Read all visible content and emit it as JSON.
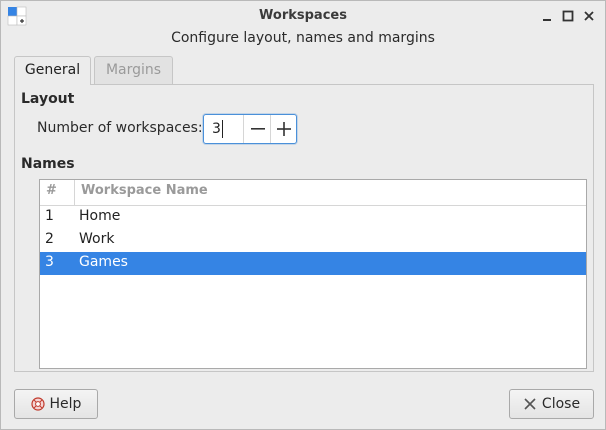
{
  "window": {
    "title": "Workspaces",
    "subtitle": "Configure layout, names and margins"
  },
  "tabs": [
    {
      "label": "General",
      "active": true
    },
    {
      "label": "Margins",
      "active": false
    }
  ],
  "layout": {
    "section_title": "Layout",
    "workspaces_label": "Number of workspaces:",
    "workspaces_value": "3"
  },
  "names": {
    "section_title": "Names",
    "columns": [
      "#",
      "Workspace Name"
    ],
    "rows": [
      {
        "num": "1",
        "name": "Home",
        "selected": false
      },
      {
        "num": "2",
        "name": "Work",
        "selected": false
      },
      {
        "num": "3",
        "name": "Games",
        "selected": true
      }
    ]
  },
  "buttons": {
    "help_label": "Help",
    "close_label": "Close"
  },
  "colors": {
    "selection": "#3584e4",
    "focus_border": "#4a90d9"
  },
  "icons": {
    "app": "workspaces-app-icon",
    "help": "help-icon",
    "close": "close-icon"
  }
}
